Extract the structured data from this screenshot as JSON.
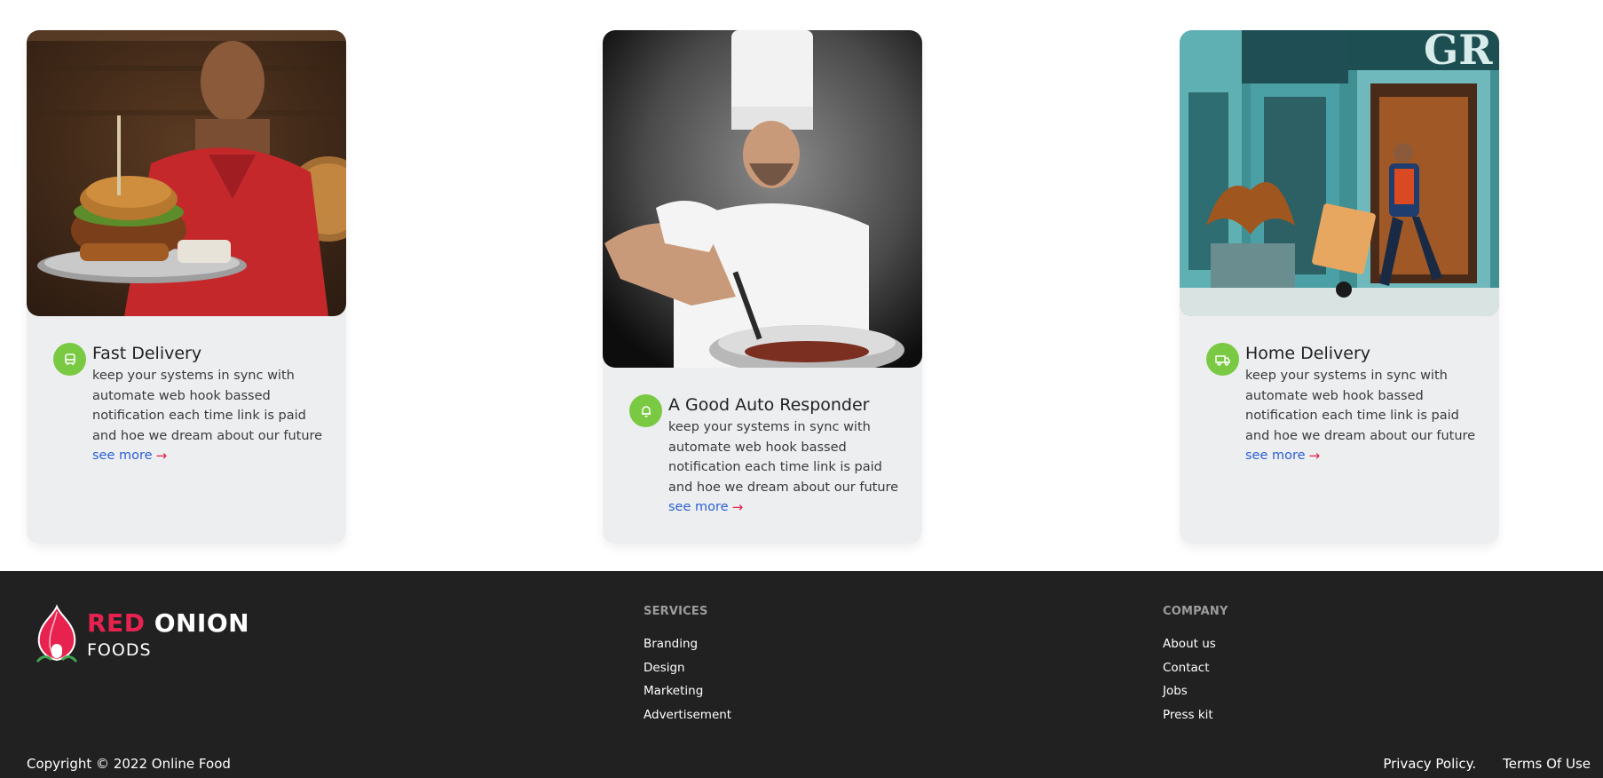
{
  "cards": [
    {
      "image": "burger-waiter-photo",
      "icon": "bus-icon",
      "title": "Fast Delivery",
      "description": "keep your systems in sync with automate web hook bassed notification each time link is paid and hoe we dream about our future",
      "link_label": "see more"
    },
    {
      "image": "chef-cooking-photo",
      "icon": "bell-icon",
      "title": "A Good Auto Responder",
      "description": "keep your systems in sync with automate web hook bassed notification each time link is paid and hoe we dream about our future",
      "link_label": "see more"
    },
    {
      "image": "courier-delivery-photo",
      "icon": "truck-icon",
      "title": "Home Delivery",
      "description": "keep your systems in sync with automate web hook bassed notification each time link is paid and hoe we dream about our future",
      "link_label": "see more"
    }
  ],
  "footer": {
    "logo": {
      "word_red": "RED",
      "word_white": "ONION",
      "subtitle": "FOODS"
    },
    "services": {
      "heading": "SERVICES",
      "links": [
        "Branding",
        "Design",
        "Marketing",
        "Advertisement"
      ]
    },
    "company": {
      "heading": "COMPANY",
      "links": [
        "About us",
        "Contact",
        "Jobs",
        "Press kit"
      ]
    },
    "copyright": "Copyright © 2022 Online Food",
    "legal": [
      "Privacy Policy.",
      "Terms Of Use"
    ]
  },
  "colors": {
    "accent_green": "#7ac943",
    "brand_red": "#e8224f",
    "link_blue": "#2c5fd6",
    "footer_bg": "#212121",
    "card_bg": "#edeef0"
  }
}
